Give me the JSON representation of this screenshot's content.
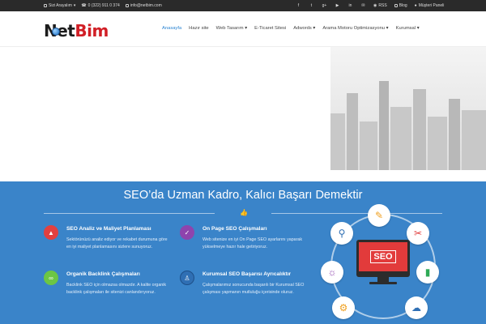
{
  "topbar": {
    "call_label": "Sizi Arayalım",
    "phone": "0 (322) 911 0 374",
    "email": "info@netbim.com",
    "social": [
      "f",
      "t",
      "g+",
      "▶",
      "in",
      "✉"
    ],
    "rss": "RSS",
    "blog": "Blog",
    "customer_panel": "Müşteri Paneli"
  },
  "logo": {
    "part1": "Net",
    "part2": "Bim"
  },
  "nav": {
    "items": [
      "Anasayfa",
      "Hazır site",
      "Web Tasarım",
      "E-Ticaret Sitesi",
      "Adwords",
      "Arama Motoru Optimizasyonu",
      "Kurumsal"
    ],
    "active_index": 0
  },
  "section": {
    "headline": "SEO’da Uzman Kadro, Kalıcı Başarı Demektir"
  },
  "features": [
    {
      "title": "SEO Analiz ve Maliyet Planlaması",
      "text": "Sektörünüzü analiz ediyor ve rekabet durumuna göre en iyi maliyet planlamasını sizlere sunuyoruz.",
      "icon": "chart-icon",
      "color": "#e24040"
    },
    {
      "title": "On Page SEO Çalışmaları",
      "text": "Web sitenize en iyi On Page SEO ayarlarını yaparak yükselmeye hazır hale getiriyoruz.",
      "icon": "check-icon",
      "color": "#8e44ad"
    },
    {
      "title": "Organik Backlink Çalışmaları",
      "text": "Backlink SEO için olmazsa olmazdır. A kalite organik backlink çalışmaları ile sitenizi canlandırıyoruz.",
      "icon": "link-icon",
      "color": "#6cc644"
    },
    {
      "title": "Kurumsal SEO Başarısı Ayrıcalıktır",
      "text": "Çalışmalarımız sonucunda başarılı bir Kurumsal SEO çalışması yapmanın mutluluğu içerisinde oluruz.",
      "icon": "person-icon",
      "color": "#2f6fb4"
    }
  ],
  "illustration": {
    "screen_text": "SEO"
  },
  "colors": {
    "blue": "#3a84c9",
    "accent": "#2b84d2",
    "brand_red": "#d11f26"
  }
}
